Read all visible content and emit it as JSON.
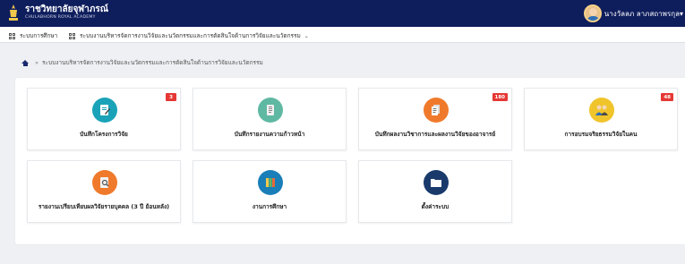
{
  "header": {
    "title": "ราชวิทยาลัยจุฬาภรณ์",
    "subtitle": "CHULABHORN ROYAL ACADEMY",
    "user_name": "นางวัลลภ ลาภสถาพรกุล",
    "user_caret": "▾"
  },
  "menu": {
    "items": [
      {
        "label": "ระบบการศึกษา"
      },
      {
        "label": "ระบบงานบริหารจัดการงานวิจัยและนวัตกรรมและการตัดสินใจด้านการวิจัยและนวัตกรรม",
        "chevron": "⌄"
      }
    ]
  },
  "breadcrumb": {
    "separator": "»",
    "current": "ระบบงานบริหารจัดการงานวิจัยและนวัตกรรมและการตัดสินใจด้านการวิจัยและนวัตกรรม"
  },
  "cards": [
    {
      "label": "บันทึกโครงการวิจัย",
      "badge": "3",
      "icon": "edit-document-icon",
      "color": "#1aa3b8"
    },
    {
      "label": "บันทึกรายงานความก้าวหน้า",
      "icon": "report-icon",
      "color": "#5fb8a2"
    },
    {
      "label": "บันทึกผลงานวิชาการและผลงานวิจัยของอาจารย์",
      "badge": "180",
      "icon": "papers-icon",
      "color": "#f07a2b"
    },
    {
      "label": "การอบรมจริยธรรมวิจัยในคน",
      "badge": "48",
      "icon": "people-icon",
      "color": "#f0c42b"
    },
    {
      "label": "รายงานเปรียบเทียบผลวิจัยรายบุคคล (3 ปี ย้อนหลัง)",
      "icon": "search-document-icon",
      "color": "#f07a2b"
    },
    {
      "label": "งานการศึกษา",
      "icon": "books-icon",
      "color": "#1a7fb8"
    },
    {
      "label": "ตั้งค่าระบบ",
      "icon": "folder-icon",
      "color": "#1a3a6c"
    }
  ]
}
